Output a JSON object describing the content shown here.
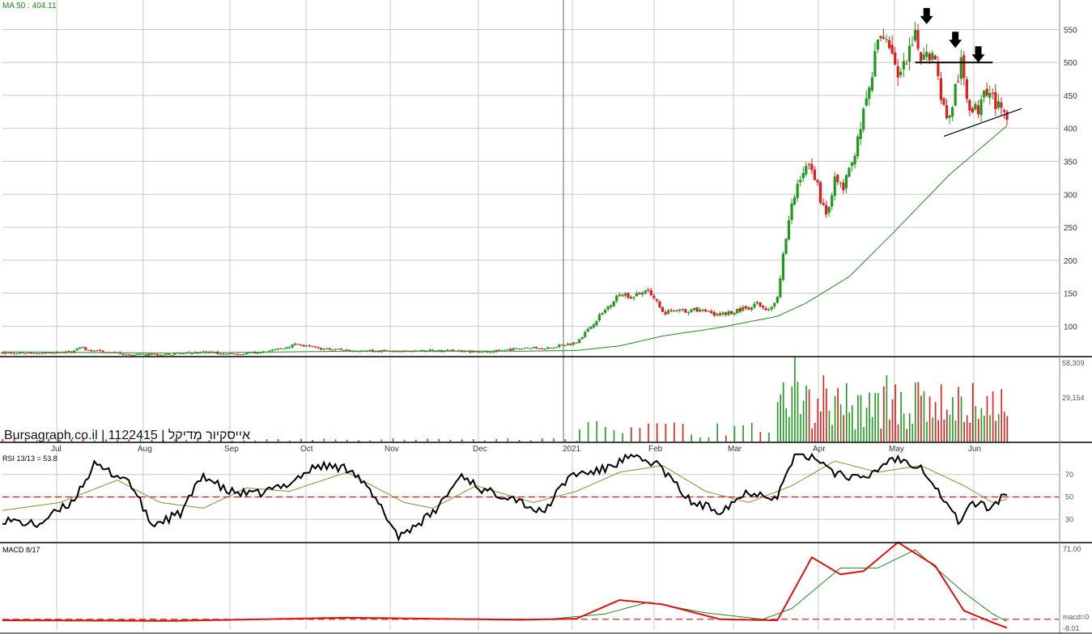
{
  "chart_data": [
    {
      "type": "candlestick",
      "panel": "price",
      "indicator_label": "MA 50 : 404.11",
      "watermark": "Bursagraph.co.il | 1122415 | אייסקיור מדיקל",
      "ylim": [
        55,
        580
      ],
      "yticks": [
        100,
        150,
        200,
        250,
        300,
        350,
        400,
        450,
        500,
        550
      ],
      "month_labels": [
        "Jul",
        "Aug",
        "Sep",
        "Oct",
        "Nov",
        "Dec",
        "2021",
        "Feb",
        "Mar",
        "Apr",
        "May",
        "Jun"
      ],
      "year_divider_label": "2021",
      "anchors": [
        {
          "d": 0,
          "v": 60
        },
        {
          "d": 15,
          "v": 59
        },
        {
          "d": 24,
          "v": 61
        },
        {
          "d": 26,
          "v": 67
        },
        {
          "d": 35,
          "v": 61
        },
        {
          "d": 45,
          "v": 56
        },
        {
          "d": 60,
          "v": 58
        },
        {
          "d": 72,
          "v": 61
        },
        {
          "d": 78,
          "v": 57
        },
        {
          "d": 85,
          "v": 58
        },
        {
          "d": 95,
          "v": 64
        },
        {
          "d": 102,
          "v": 72
        },
        {
          "d": 110,
          "v": 66
        },
        {
          "d": 125,
          "v": 62
        },
        {
          "d": 140,
          "v": 62
        },
        {
          "d": 150,
          "v": 63
        },
        {
          "d": 160,
          "v": 62
        },
        {
          "d": 170,
          "v": 61
        },
        {
          "d": 180,
          "v": 66
        },
        {
          "d": 190,
          "v": 67
        },
        {
          "d": 200,
          "v": 75
        },
        {
          "d": 205,
          "v": 100
        },
        {
          "d": 210,
          "v": 125
        },
        {
          "d": 215,
          "v": 150
        },
        {
          "d": 220,
          "v": 145
        },
        {
          "d": 225,
          "v": 158
        },
        {
          "d": 230,
          "v": 120
        },
        {
          "d": 240,
          "v": 125
        },
        {
          "d": 250,
          "v": 118
        },
        {
          "d": 260,
          "v": 128
        },
        {
          "d": 262,
          "v": 135
        },
        {
          "d": 267,
          "v": 125
        },
        {
          "d": 270,
          "v": 145
        },
        {
          "d": 272,
          "v": 210
        },
        {
          "d": 275,
          "v": 280
        },
        {
          "d": 278,
          "v": 330
        },
        {
          "d": 282,
          "v": 345
        },
        {
          "d": 285,
          "v": 295
        },
        {
          "d": 287,
          "v": 270
        },
        {
          "d": 290,
          "v": 320
        },
        {
          "d": 293,
          "v": 310
        },
        {
          "d": 296,
          "v": 345
        },
        {
          "d": 298,
          "v": 390
        },
        {
          "d": 300,
          "v": 420
        },
        {
          "d": 303,
          "v": 480
        },
        {
          "d": 305,
          "v": 530
        },
        {
          "d": 307,
          "v": 545
        },
        {
          "d": 310,
          "v": 520
        },
        {
          "d": 312,
          "v": 470
        },
        {
          "d": 315,
          "v": 500
        },
        {
          "d": 318,
          "v": 535
        },
        {
          "d": 320,
          "v": 510
        },
        {
          "d": 322,
          "v": 525
        },
        {
          "d": 325,
          "v": 500
        },
        {
          "d": 328,
          "v": 430
        },
        {
          "d": 330,
          "v": 415
        },
        {
          "d": 332,
          "v": 460
        },
        {
          "d": 334,
          "v": 495
        },
        {
          "d": 336,
          "v": 450
        },
        {
          "d": 338,
          "v": 425
        },
        {
          "d": 340,
          "v": 430
        },
        {
          "d": 342,
          "v": 470
        },
        {
          "d": 344,
          "v": 455
        },
        {
          "d": 346,
          "v": 440
        },
        {
          "d": 348,
          "v": 420
        },
        {
          "d": 350,
          "v": 425
        }
      ],
      "ma_anchors": [
        {
          "d": 0,
          "v": 61
        },
        {
          "d": 60,
          "v": 59
        },
        {
          "d": 120,
          "v": 62
        },
        {
          "d": 180,
          "v": 62
        },
        {
          "d": 200,
          "v": 63
        },
        {
          "d": 215,
          "v": 70
        },
        {
          "d": 230,
          "v": 85
        },
        {
          "d": 250,
          "v": 98
        },
        {
          "d": 270,
          "v": 115
        },
        {
          "d": 280,
          "v": 135
        },
        {
          "d": 295,
          "v": 175
        },
        {
          "d": 310,
          "v": 240
        },
        {
          "d": 330,
          "v": 330
        },
        {
          "d": 350,
          "v": 404
        }
      ],
      "annotations": {
        "resistance_level": 500,
        "resistance_from_day": 318,
        "resistance_to_day": 345,
        "support_line": [
          {
            "d": 328,
            "v": 388
          },
          {
            "d": 355,
            "v": 430
          }
        ],
        "down_arrows": [
          {
            "d": 322,
            "v": 558
          },
          {
            "d": 332,
            "v": 522
          },
          {
            "d": 340,
            "v": 500
          }
        ]
      }
    },
    {
      "type": "bar",
      "panel": "volume",
      "ytick_labels": [
        "58,309",
        "29,154"
      ],
      "ymax": 58309,
      "high_volume_range": [
        270,
        350
      ]
    },
    {
      "type": "line",
      "panel": "rsi",
      "label": "RSI 13/13 = 53.8",
      "ylim": [
        10,
        90
      ],
      "yticks": [
        70,
        50,
        30
      ],
      "reference_line": 50,
      "anchors": [
        {
          "d": 0,
          "v": 30
        },
        {
          "d": 12,
          "v": 25
        },
        {
          "d": 24,
          "v": 45
        },
        {
          "d": 32,
          "v": 78
        },
        {
          "d": 44,
          "v": 65
        },
        {
          "d": 52,
          "v": 25
        },
        {
          "d": 62,
          "v": 35
        },
        {
          "d": 70,
          "v": 70
        },
        {
          "d": 78,
          "v": 55
        },
        {
          "d": 88,
          "v": 52
        },
        {
          "d": 98,
          "v": 60
        },
        {
          "d": 110,
          "v": 78
        },
        {
          "d": 122,
          "v": 75
        },
        {
          "d": 132,
          "v": 40
        },
        {
          "d": 138,
          "v": 15
        },
        {
          "d": 150,
          "v": 35
        },
        {
          "d": 160,
          "v": 70
        },
        {
          "d": 168,
          "v": 55
        },
        {
          "d": 178,
          "v": 50
        },
        {
          "d": 188,
          "v": 35
        },
        {
          "d": 198,
          "v": 70
        },
        {
          "d": 208,
          "v": 73
        },
        {
          "d": 218,
          "v": 85
        },
        {
          "d": 228,
          "v": 80
        },
        {
          "d": 240,
          "v": 45
        },
        {
          "d": 250,
          "v": 38
        },
        {
          "d": 260,
          "v": 55
        },
        {
          "d": 270,
          "v": 50
        },
        {
          "d": 276,
          "v": 88
        },
        {
          "d": 284,
          "v": 85
        },
        {
          "d": 290,
          "v": 72
        },
        {
          "d": 300,
          "v": 65
        },
        {
          "d": 310,
          "v": 85
        },
        {
          "d": 320,
          "v": 78
        },
        {
          "d": 330,
          "v": 40
        },
        {
          "d": 333,
          "v": 28
        },
        {
          "d": 338,
          "v": 45
        },
        {
          "d": 344,
          "v": 40
        },
        {
          "d": 350,
          "v": 54
        }
      ],
      "signal_anchors": [
        {
          "d": 0,
          "v": 38
        },
        {
          "d": 20,
          "v": 45
        },
        {
          "d": 40,
          "v": 65
        },
        {
          "d": 55,
          "v": 45
        },
        {
          "d": 70,
          "v": 40
        },
        {
          "d": 85,
          "v": 58
        },
        {
          "d": 100,
          "v": 55
        },
        {
          "d": 120,
          "v": 72
        },
        {
          "d": 140,
          "v": 45
        },
        {
          "d": 150,
          "v": 40
        },
        {
          "d": 165,
          "v": 60
        },
        {
          "d": 185,
          "v": 45
        },
        {
          "d": 200,
          "v": 55
        },
        {
          "d": 215,
          "v": 72
        },
        {
          "d": 230,
          "v": 78
        },
        {
          "d": 245,
          "v": 55
        },
        {
          "d": 260,
          "v": 45
        },
        {
          "d": 275,
          "v": 60
        },
        {
          "d": 290,
          "v": 82
        },
        {
          "d": 305,
          "v": 72
        },
        {
          "d": 320,
          "v": 78
        },
        {
          "d": 335,
          "v": 60
        },
        {
          "d": 345,
          "v": 45
        },
        {
          "d": 350,
          "v": 48
        }
      ]
    },
    {
      "type": "line",
      "panel": "macd",
      "label": "MACD 8/17",
      "ylim": [
        -10,
        71
      ],
      "ytick_labels": [
        "71.00",
        "macd=0",
        "-8.01"
      ],
      "reference_line": 0,
      "anchors": [
        {
          "d": 0,
          "v": -1
        },
        {
          "d": 60,
          "v": -1.5
        },
        {
          "d": 120,
          "v": 1.5
        },
        {
          "d": 180,
          "v": -0.5
        },
        {
          "d": 200,
          "v": 0.5
        },
        {
          "d": 215,
          "v": 18
        },
        {
          "d": 230,
          "v": 14
        },
        {
          "d": 250,
          "v": 0
        },
        {
          "d": 270,
          "v": -1
        },
        {
          "d": 282,
          "v": 58
        },
        {
          "d": 292,
          "v": 42
        },
        {
          "d": 300,
          "v": 45
        },
        {
          "d": 312,
          "v": 72
        },
        {
          "d": 325,
          "v": 50
        },
        {
          "d": 335,
          "v": 8
        },
        {
          "d": 345,
          "v": -3
        },
        {
          "d": 350,
          "v": -8
        }
      ],
      "signal_anchors": [
        {
          "d": 0,
          "v": -0.5
        },
        {
          "d": 60,
          "v": -1
        },
        {
          "d": 120,
          "v": 1
        },
        {
          "d": 190,
          "v": 0
        },
        {
          "d": 210,
          "v": 5
        },
        {
          "d": 225,
          "v": 16
        },
        {
          "d": 245,
          "v": 6
        },
        {
          "d": 265,
          "v": 0
        },
        {
          "d": 275,
          "v": 10
        },
        {
          "d": 292,
          "v": 48
        },
        {
          "d": 305,
          "v": 48
        },
        {
          "d": 318,
          "v": 65
        },
        {
          "d": 335,
          "v": 25
        },
        {
          "d": 345,
          "v": 5
        },
        {
          "d": 350,
          "v": -2
        }
      ]
    }
  ],
  "colors": {
    "up": "#1d9a1d",
    "down": "#e31b1b",
    "ma": "#1c8a1c",
    "grid": "#c8c8c8",
    "rsi": "#000000",
    "rsi_signal": "#8b8b2b",
    "macd": "#e01010",
    "macd_signal": "#1c8a1c",
    "reference": "#e01010"
  }
}
